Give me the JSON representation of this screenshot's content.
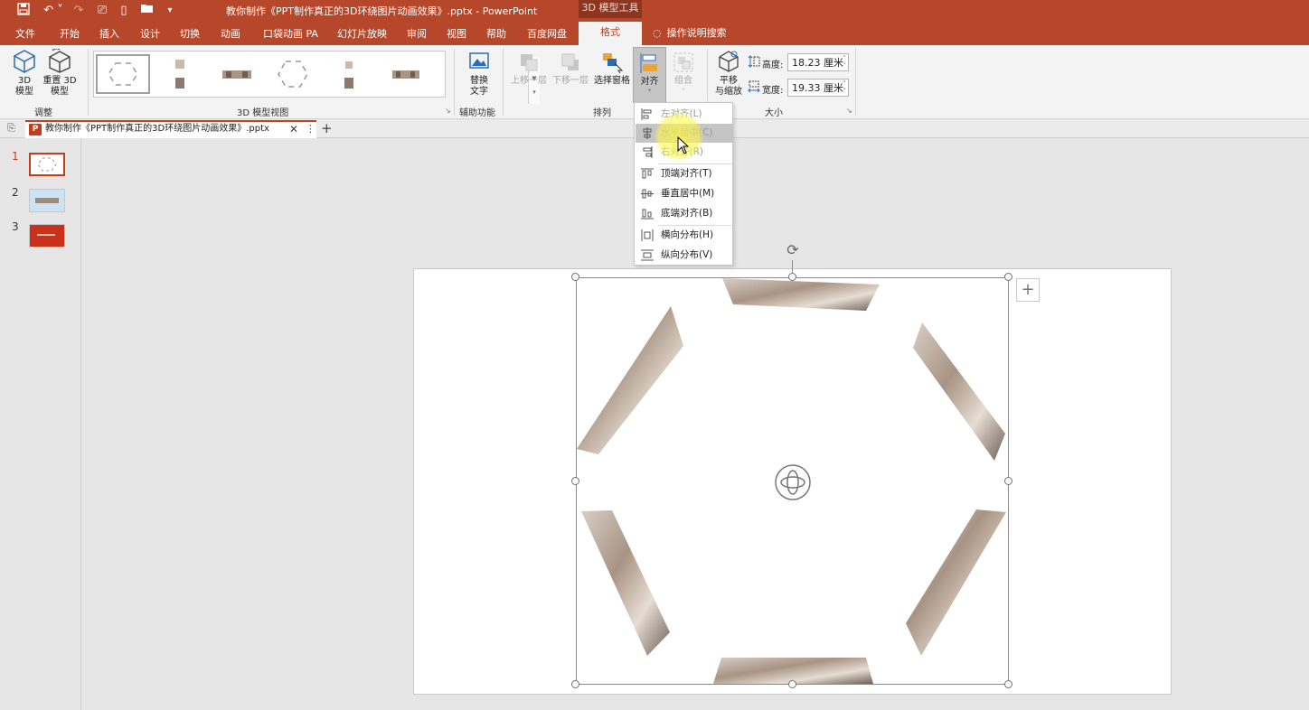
{
  "titlebar": {
    "title": "教你制作《PPT制作真正的3D环绕图片动画效果》.pptx  -  PowerPoint",
    "context_tab": "3D 模型工具"
  },
  "tabs": [
    "文件",
    "开始",
    "插入",
    "设计",
    "切换",
    "动画",
    "口袋动画 PA",
    "幻灯片放映",
    "审阅",
    "视图",
    "帮助",
    "百度网盘"
  ],
  "active_tab": "格式",
  "tell_me": "操作说明搜索",
  "ribbon": {
    "adjust": {
      "btn_3d_model": "3D\n模型",
      "btn_reset": "重置 3D\n模型",
      "label": "调整"
    },
    "views": {
      "label": "3D 模型视图"
    },
    "accessibility": {
      "btn_alt_text": "替换\n文字",
      "label": "辅助功能"
    },
    "arrange": {
      "btn_bring_forward": "上移一层",
      "btn_send_backward": "下移一层",
      "btn_selection_pane": "选择窗格",
      "btn_align": "对齐",
      "btn_group": "组合",
      "label": "排列"
    },
    "size": {
      "btn_pan_zoom": "平移\n与缩放",
      "height_label": "高度:",
      "height_value": "18.23 厘米",
      "width_label": "宽度:",
      "width_value": "19.33 厘米",
      "label": "大小"
    }
  },
  "document_tab": {
    "name": "教你制作《PPT制作真正的3D环绕图片动画效果》.pptx",
    "icon_letter": "P"
  },
  "thumbnails": [
    "1",
    "2",
    "3"
  ],
  "align_menu": [
    {
      "label": "左对齐(L)",
      "disabled": true
    },
    {
      "label": "水平居中(C)",
      "disabled": true,
      "hover": true
    },
    {
      "label": "右对齐(R)",
      "disabled": true
    },
    {
      "label": "顶端对齐(T)",
      "disabled": false
    },
    {
      "label": "垂直居中(M)",
      "disabled": false
    },
    {
      "label": "底端对齐(B)",
      "disabled": false
    },
    {
      "label": "横向分布(H)",
      "disabled": false
    },
    {
      "label": "纵向分布(V)",
      "disabled": false
    }
  ],
  "colors": {
    "accent": "#b7472a",
    "ribbon_bg": "#f3f3f3",
    "workspace_bg": "#e6e6e6"
  }
}
